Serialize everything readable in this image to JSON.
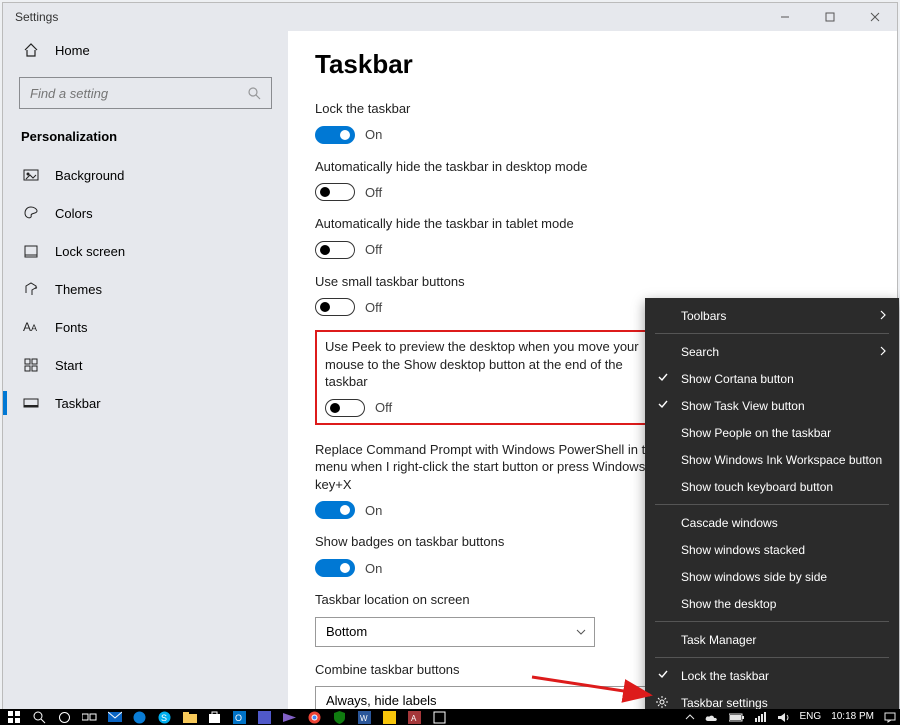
{
  "title": "Settings",
  "home_label": "Home",
  "search_placeholder": "Find a setting",
  "section": "Personalization",
  "nav": [
    {
      "key": "background",
      "label": "Background"
    },
    {
      "key": "colors",
      "label": "Colors"
    },
    {
      "key": "lockscreen",
      "label": "Lock screen"
    },
    {
      "key": "themes",
      "label": "Themes"
    },
    {
      "key": "fonts",
      "label": "Fonts"
    },
    {
      "key": "start",
      "label": "Start"
    },
    {
      "key": "taskbar",
      "label": "Taskbar"
    }
  ],
  "page_heading": "Taskbar",
  "toggles": {
    "lock": {
      "label": "Lock the taskbar",
      "state": "On",
      "on": true
    },
    "hide_desktop": {
      "label": "Automatically hide the taskbar in desktop mode",
      "state": "Off",
      "on": false
    },
    "hide_tablet": {
      "label": "Automatically hide the taskbar in tablet mode",
      "state": "Off",
      "on": false
    },
    "small": {
      "label": "Use small taskbar buttons",
      "state": "Off",
      "on": false
    },
    "peek": {
      "label": "Use Peek to preview the desktop when you move your mouse to the Show desktop button at the end of the taskbar",
      "state": "Off",
      "on": false
    },
    "powershell": {
      "label": "Replace Command Prompt with Windows PowerShell in the menu when I right-click the start button or press Windows key+X",
      "state": "On",
      "on": true
    },
    "badges": {
      "label": "Show badges on taskbar buttons",
      "state": "On",
      "on": true
    }
  },
  "location_label": "Taskbar location on screen",
  "location_value": "Bottom",
  "combine_label": "Combine taskbar buttons",
  "combine_value": "Always, hide labels",
  "ctx": {
    "toolbars": "Toolbars",
    "search": "Search",
    "cortana": "Show Cortana button",
    "taskview": "Show Task View button",
    "people": "Show People on the taskbar",
    "ink": "Show Windows Ink Workspace button",
    "keyboard": "Show touch keyboard button",
    "cascade": "Cascade windows",
    "stacked": "Show windows stacked",
    "sidebyside": "Show windows side by side",
    "showdesktop": "Show the desktop",
    "taskmanager": "Task Manager",
    "locktb": "Lock the taskbar",
    "tbsettings": "Taskbar settings"
  },
  "tray": {
    "lang": "ENG",
    "time": "10:18 PM"
  }
}
